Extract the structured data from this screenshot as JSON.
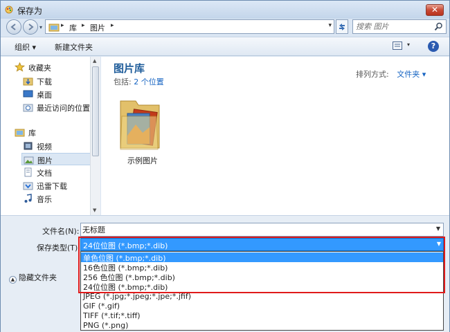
{
  "window": {
    "title": "保存为"
  },
  "address": {
    "crumbs": [
      "库",
      "图片"
    ]
  },
  "search": {
    "placeholder": "搜索 图片"
  },
  "toolbar": {
    "organize": "组织 ▾",
    "new_folder": "新建文件夹"
  },
  "nav": {
    "favorites": "收藏夹",
    "fav_items": [
      "下载",
      "桌面",
      "最近访问的位置"
    ],
    "libraries": "库",
    "lib_items": [
      "视频",
      "图片",
      "文档",
      "迅雷下载",
      "音乐"
    ],
    "selected": "图片"
  },
  "content": {
    "title": "图片库",
    "includes_label": "包括:",
    "includes_link": "2 个位置",
    "arrange_label": "排列方式:",
    "arrange_value": "文件夹 ▾",
    "folder_name": "示例图片"
  },
  "form": {
    "filename_label": "文件名(N):",
    "filename_value": "无标题",
    "filetype_label": "保存类型(T):",
    "filetype_value": "24位位图 (*.bmp;*.dib)",
    "hide_folders": "隐藏文件夹"
  },
  "filetype_options": [
    "单色位图 (*.bmp;*.dib)",
    "16色位图 (*.bmp;*.dib)",
    "256 色位图 (*.bmp;*.dib)",
    "24位位图 (*.bmp;*.dib)",
    "JPEG (*.jpg;*.jpeg;*.jpe;*.jfif)",
    "GIF (*.gif)",
    "TIFF (*.tif;*.tiff)",
    "PNG (*.png)"
  ],
  "highlighted_option": 0,
  "colors": {
    "accent": "#3399ff",
    "highlight_border": "#e01a1a",
    "link": "#1563c2",
    "title": "#1e5c9a"
  }
}
